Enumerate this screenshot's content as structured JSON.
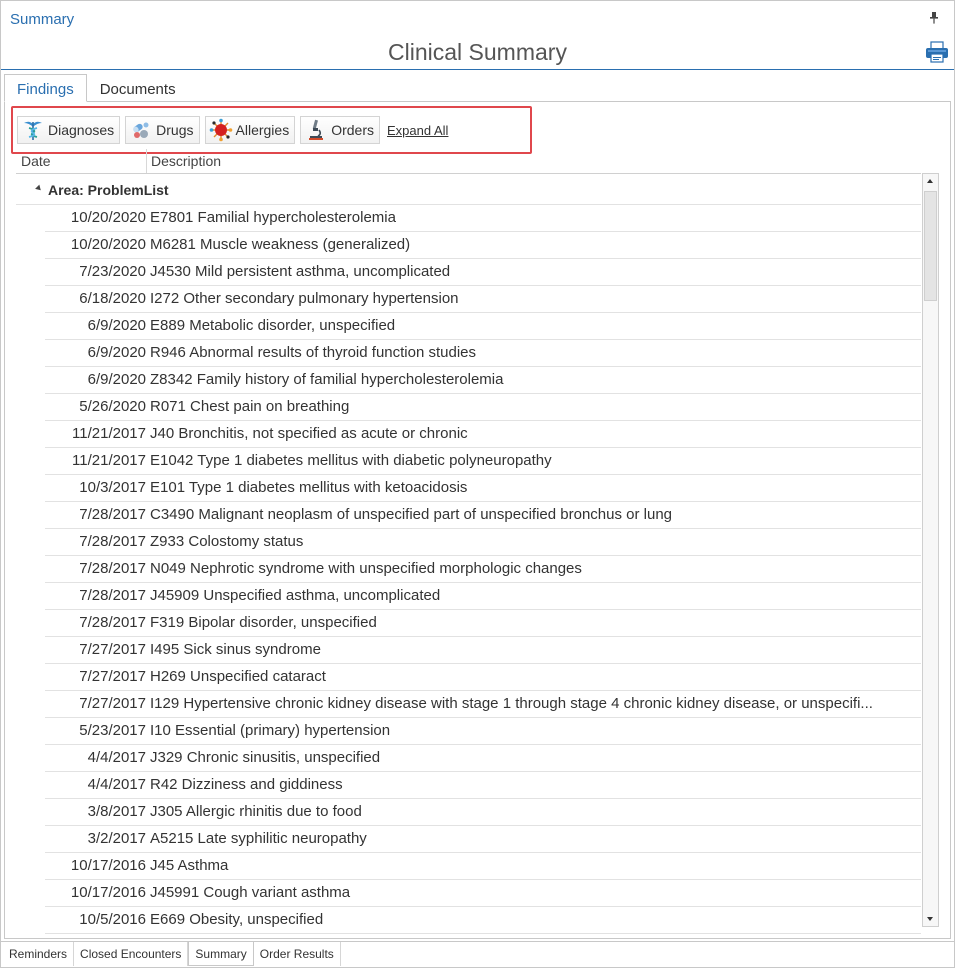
{
  "panel": {
    "title": "Summary",
    "main_title": "Clinical Summary",
    "pin_icon": "pin-icon",
    "print_icon": "printer-icon"
  },
  "tabs": [
    {
      "label": "Findings",
      "active": true
    },
    {
      "label": "Documents",
      "active": false
    }
  ],
  "toolbar": {
    "buttons": [
      {
        "label": "Diagnoses",
        "icon": "caduceus-icon"
      },
      {
        "label": "Drugs",
        "icon": "pills-icon"
      },
      {
        "label": "Allergies",
        "icon": "allergen-icon"
      },
      {
        "label": "Orders",
        "icon": "microscope-icon"
      }
    ],
    "expand_all": "Expand All",
    "highlight_color": "#e0474c"
  },
  "grid": {
    "columns": [
      "Date",
      "Description"
    ],
    "group_label": "Area: ProblemList",
    "rows": [
      {
        "date": "10/20/2020",
        "description": "E7801 Familial hypercholesterolemia"
      },
      {
        "date": "10/20/2020",
        "description": "M6281 Muscle weakness (generalized)"
      },
      {
        "date": "7/23/2020",
        "description": "J4530 Mild persistent asthma, uncomplicated"
      },
      {
        "date": "6/18/2020",
        "description": "I272 Other secondary pulmonary hypertension"
      },
      {
        "date": "6/9/2020",
        "description": "E889 Metabolic disorder, unspecified"
      },
      {
        "date": "6/9/2020",
        "description": "R946 Abnormal results of thyroid function studies"
      },
      {
        "date": "6/9/2020",
        "description": "Z8342 Family history of familial hypercholesterolemia"
      },
      {
        "date": "5/26/2020",
        "description": "R071 Chest pain on breathing"
      },
      {
        "date": "11/21/2017",
        "description": "J40 Bronchitis, not specified as acute or chronic"
      },
      {
        "date": "11/21/2017",
        "description": "E1042 Type 1 diabetes mellitus with diabetic polyneuropathy"
      },
      {
        "date": "10/3/2017",
        "description": "E101 Type 1 diabetes mellitus with ketoacidosis"
      },
      {
        "date": "7/28/2017",
        "description": "C3490 Malignant neoplasm of unspecified part of unspecified bronchus or lung"
      },
      {
        "date": "7/28/2017",
        "description": "Z933 Colostomy status"
      },
      {
        "date": "7/28/2017",
        "description": "N049 Nephrotic syndrome with unspecified morphologic changes"
      },
      {
        "date": "7/28/2017",
        "description": "J45909 Unspecified asthma, uncomplicated"
      },
      {
        "date": "7/28/2017",
        "description": "F319 Bipolar disorder, unspecified"
      },
      {
        "date": "7/27/2017",
        "description": "I495 Sick sinus syndrome"
      },
      {
        "date": "7/27/2017",
        "description": "H269 Unspecified cataract"
      },
      {
        "date": "7/27/2017",
        "description": "I129 Hypertensive chronic kidney disease with stage 1 through stage 4 chronic kidney disease, or unspecifi..."
      },
      {
        "date": "5/23/2017",
        "description": "I10 Essential (primary) hypertension"
      },
      {
        "date": "4/4/2017",
        "description": "J329 Chronic sinusitis, unspecified"
      },
      {
        "date": "4/4/2017",
        "description": "R42 Dizziness and giddiness"
      },
      {
        "date": "3/8/2017",
        "description": "J305 Allergic rhinitis due to food"
      },
      {
        "date": "3/2/2017",
        "description": "A5215 Late syphilitic neuropathy"
      },
      {
        "date": "10/17/2016",
        "description": "J45 Asthma"
      },
      {
        "date": "10/17/2016",
        "description": "J45991 Cough variant asthma"
      },
      {
        "date": "10/5/2016",
        "description": "E669 Obesity, unspecified"
      }
    ]
  },
  "bottom_tabs": [
    {
      "label": "Reminders",
      "active": false
    },
    {
      "label": "Closed Encounters",
      "active": false
    },
    {
      "label": "Summary",
      "active": true
    },
    {
      "label": "Order Results",
      "active": false
    }
  ]
}
